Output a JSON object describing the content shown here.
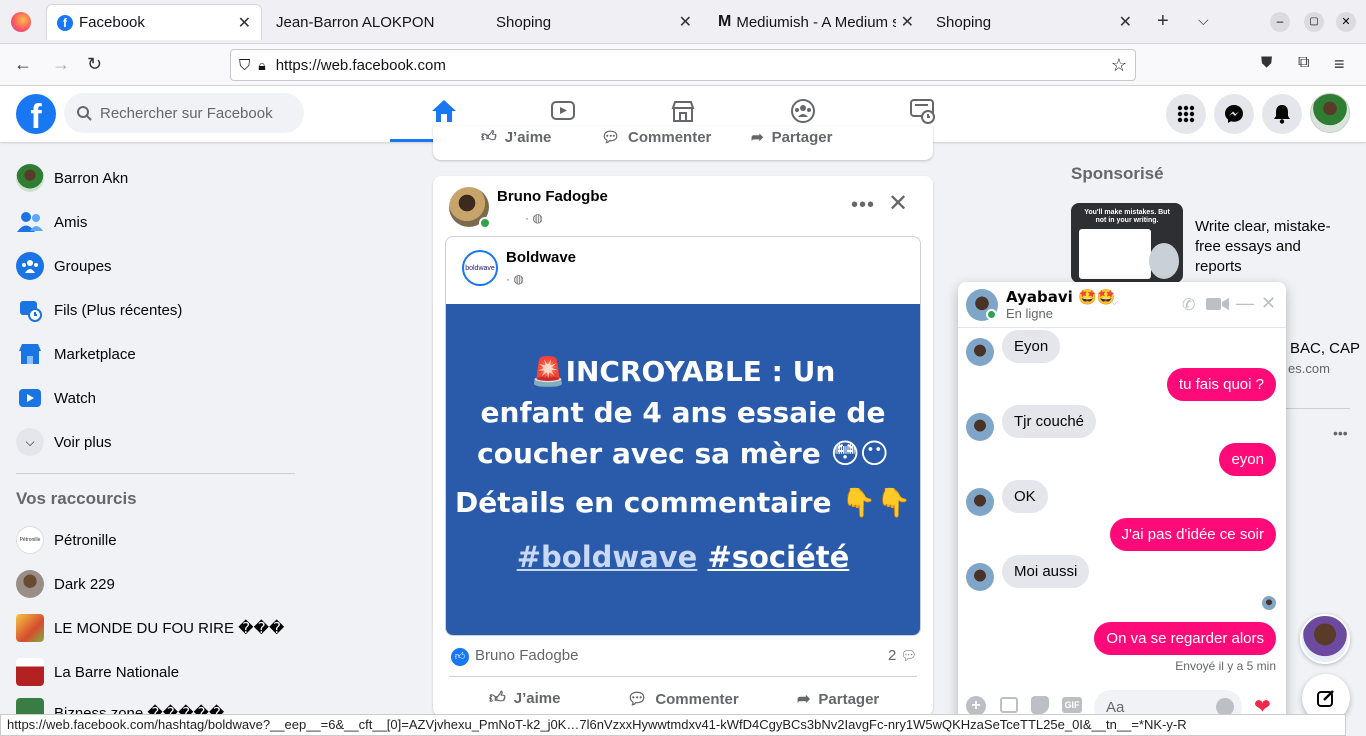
{
  "browser": {
    "tabs": [
      {
        "title": "Facebook"
      },
      {
        "title": "Jean-Barron ALOKPON"
      },
      {
        "title": "Shoping"
      },
      {
        "title": "Mediumish - A Medium s"
      },
      {
        "title": "Shoping"
      }
    ],
    "url": "https://web.facebook.com",
    "status_url": "https://web.facebook.com/hashtag/boldwave?__eep__=6&__cft__[0]=AZVjvhexu_PmNoT-k2_j0K…7l6nVzxxHywwtmdxv41-kWfD4CgyBCs3bNv2IavgFc-nry1W5wQKHzaSeTceTTL25e_0I&__tn__=*NK-y-R"
  },
  "header": {
    "search_placeholder": "Rechercher sur Facebook"
  },
  "sidebar": {
    "items": [
      {
        "label": "Barron Akn"
      },
      {
        "label": "Amis"
      },
      {
        "label": "Groupes"
      },
      {
        "label": "Fils (Plus récentes)"
      },
      {
        "label": "Marketplace"
      },
      {
        "label": "Watch"
      },
      {
        "label": "Voir plus"
      }
    ],
    "shortcuts_title": "Vos raccourcis",
    "shortcuts": [
      {
        "label": "Pétronille"
      },
      {
        "label": "Dark 229"
      },
      {
        "label": "LE MONDE DU FOU RIRE ���"
      },
      {
        "label": "La Barre Nationale"
      },
      {
        "label": "Bizness zone �����"
      }
    ]
  },
  "prev_post": {
    "like": "J’aime",
    "comment": "Commenter",
    "share": "Partager"
  },
  "post": {
    "author": "Bruno Fadogbe",
    "shared_page": "Boldwave",
    "shared_page_logo": "boldwave",
    "headline": "🚨INCROYABLE : Un enfant de 4 ans essaie de coucher avec sa mère 😳😶",
    "details": "Détails en commentaire 👇👇",
    "hashtag1": "#boldwave",
    "hashtag2": "#société",
    "reaction_name": "Bruno Fadogbe",
    "comment_count": "2",
    "like": "J’aime",
    "comment": "Commenter",
    "share": "Partager",
    "bg_color": "#2a5bab"
  },
  "right": {
    "sponsored_title": "Sponsorisé",
    "ad1_text": "Write clear, mistake-free essays and reports",
    "ad1_thumb_title": "You'll make mistakes. But not in your writing.",
    "ad2_text": "BAC, CAP",
    "ad2_domain": "es.com"
  },
  "chat": {
    "name": "Ayabavi 🤩🤩",
    "status": "En ligne",
    "messages": [
      {
        "dir": "in",
        "text": "Eyon"
      },
      {
        "dir": "out",
        "text": "tu fais quoi ?"
      },
      {
        "dir": "in",
        "text": "Tjr couché"
      },
      {
        "dir": "out",
        "text": "eyon"
      },
      {
        "dir": "in",
        "text": "OK"
      },
      {
        "dir": "out",
        "text": "J'ai pas d'idée ce soir"
      },
      {
        "dir": "in",
        "text": "Moi aussi"
      },
      {
        "dir": "out",
        "text": "On va se regarder alors"
      }
    ],
    "sent_status": "Envoyé il y a 5 min",
    "input_placeholder": "Aa",
    "gif_label": "GIF"
  },
  "colors": {
    "fb_blue": "#1877f2",
    "chat_pink": "#ff0a78"
  }
}
